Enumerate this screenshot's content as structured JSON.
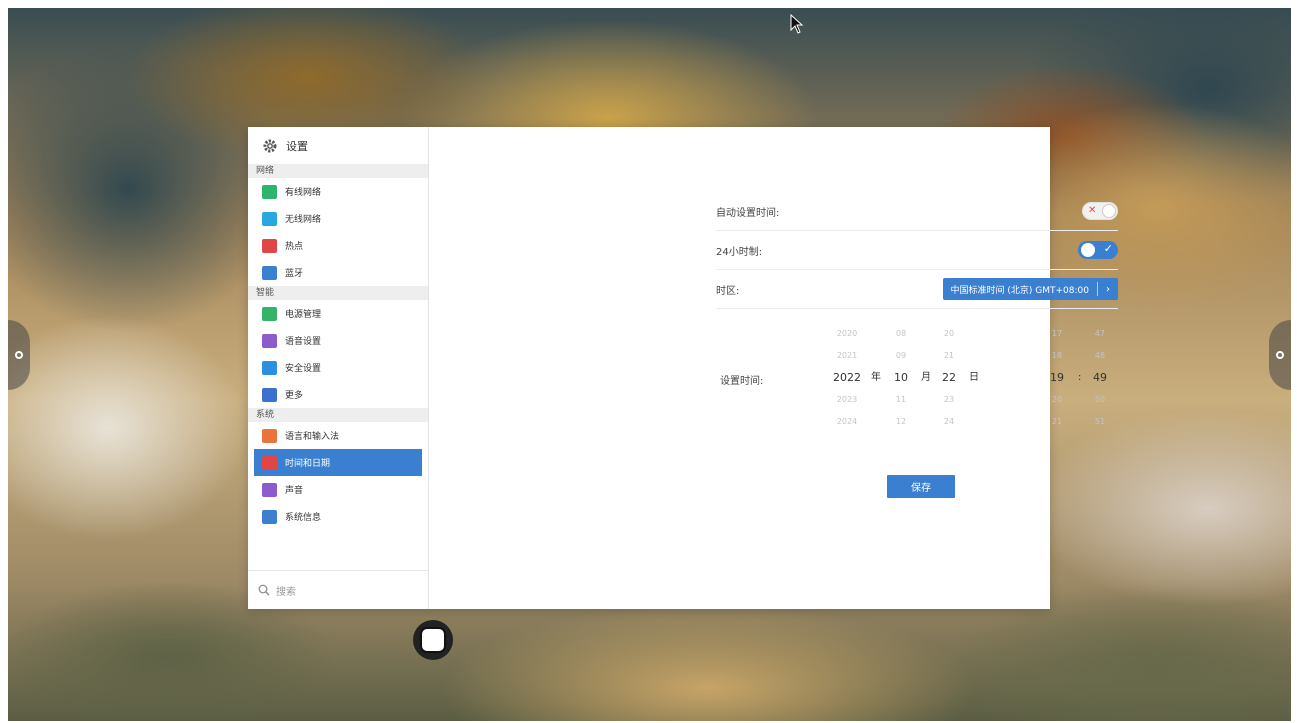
{
  "colors": {
    "accent": "#3b7fd0",
    "toggle_off_mark": "#e24b4b"
  },
  "sidebar": {
    "title": "设置",
    "sections": [
      {
        "label": "网络",
        "items": [
          {
            "label": "有线网络",
            "icon": "wired-network-icon",
            "color": "#2fb46e"
          },
          {
            "label": "无线网络",
            "icon": "wifi-icon",
            "color": "#28a7e0"
          },
          {
            "label": "热点",
            "icon": "hotspot-icon",
            "color": "#e04646"
          },
          {
            "label": "蓝牙",
            "icon": "bluetooth-icon",
            "color": "#3b7fd0"
          }
        ]
      },
      {
        "label": "智能",
        "items": [
          {
            "label": "电源管理",
            "icon": "power-icon",
            "color": "#34b36b"
          },
          {
            "label": "语音设置",
            "icon": "voice-icon",
            "color": "#8a5ccd"
          },
          {
            "label": "安全设置",
            "icon": "security-icon",
            "color": "#2c8fe0"
          },
          {
            "label": "更多",
            "icon": "more-icon",
            "color": "#3b6fd0"
          }
        ]
      },
      {
        "label": "系统",
        "items": [
          {
            "label": "语言和输入法",
            "icon": "language-icon",
            "color": "#e8743b"
          },
          {
            "label": "时间和日期",
            "icon": "calendar-icon",
            "color": "#e04646",
            "selected": true
          },
          {
            "label": "声音",
            "icon": "sound-icon",
            "color": "#8a5ccd"
          },
          {
            "label": "系统信息",
            "icon": "system-info-icon",
            "color": "#3b7fd0"
          }
        ]
      }
    ],
    "search_placeholder": "搜索"
  },
  "main": {
    "auto_time": {
      "label": "自动设置时间:",
      "enabled": false
    },
    "hour24": {
      "label": "24小时制:",
      "enabled": true
    },
    "timezone": {
      "label": "时区:",
      "value": "中国标准时间 (北京) GMT+08:00"
    },
    "set_time": {
      "label": "设置时间:",
      "year": {
        "options": [
          "2020",
          "2021",
          "2022",
          "2023",
          "2024"
        ],
        "unit": "年"
      },
      "month": {
        "options": [
          "08",
          "09",
          "10",
          "11",
          "12"
        ],
        "unit": "月"
      },
      "day": {
        "options": [
          "20",
          "21",
          "22",
          "23",
          "24"
        ],
        "unit": "日"
      },
      "hour": {
        "options": [
          "17",
          "18",
          "19",
          "20",
          "21"
        ]
      },
      "minute": {
        "options": [
          "47",
          "48",
          "49",
          "50",
          "51"
        ]
      },
      "separator": ":"
    },
    "save_label": "保存"
  }
}
